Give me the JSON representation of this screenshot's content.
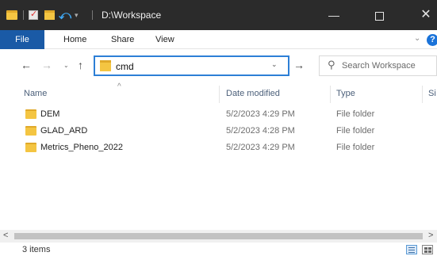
{
  "window": {
    "title": "D:\\Workspace",
    "minimize_glyph": "—",
    "close_glyph": "✕"
  },
  "quick_access": {
    "undo_glyph": "⤺",
    "dropdown_glyph": "▾"
  },
  "ribbon": {
    "tabs": [
      "File",
      "Home",
      "Share",
      "View"
    ],
    "chevron_glyph": "⌄",
    "help_glyph": "?"
  },
  "address_bar": {
    "value": "cmd",
    "back_glyph": "←",
    "forward_glyph": "→",
    "recent_glyph": "⌄",
    "up_glyph": "↑",
    "dropdown_glyph": "⌄",
    "go_glyph": "→"
  },
  "search": {
    "placeholder": "Search Workspace",
    "icon_glyph": "⚲"
  },
  "columns": {
    "name": "Name",
    "date_modified": "Date modified",
    "type": "Type",
    "size": "Si",
    "sort_caret": "^"
  },
  "files": [
    {
      "name": "DEM",
      "date": "5/2/2023 4:29 PM",
      "type": "File folder"
    },
    {
      "name": "GLAD_ARD",
      "date": "5/2/2023 4:28 PM",
      "type": "File folder"
    },
    {
      "name": "Metrics_Pheno_2022",
      "date": "5/2/2023 4:29 PM",
      "type": "File folder"
    }
  ],
  "scrollbar": {
    "left_glyph": "<",
    "right_glyph": ">"
  },
  "status": {
    "item_count": "3 items"
  },
  "colors": {
    "titlebar": "#2b2b2b",
    "file_tab": "#1a5aa6",
    "address_focus": "#2d7fd6",
    "folder": "#f4c542"
  }
}
